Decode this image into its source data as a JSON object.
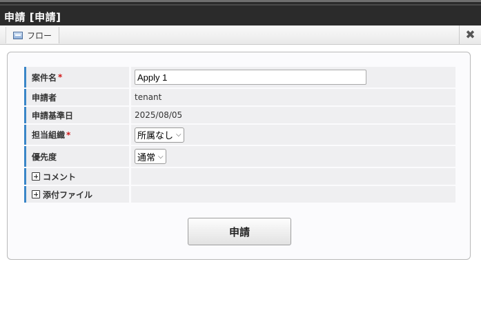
{
  "window": {
    "title": "申請 [申請]"
  },
  "toolbar": {
    "flow_label": "フロー",
    "close_icon": "close-icon"
  },
  "form": {
    "case_name": {
      "label": "案件名",
      "required_mark": "*",
      "value": "Apply 1"
    },
    "applicant": {
      "label": "申請者",
      "value": "tenant"
    },
    "base_date": {
      "label": "申請基準日",
      "value": "2025/08/05"
    },
    "organization": {
      "label": "担当組織",
      "required_mark": "*",
      "selected": "所属なし"
    },
    "priority": {
      "label": "優先度",
      "selected": "通常"
    },
    "comment": {
      "label": "コメント"
    },
    "attachments": {
      "label": "添付ファイル"
    }
  },
  "actions": {
    "apply_label": "申請"
  },
  "colors": {
    "accent": "#3a86c8",
    "required": "#d01818",
    "titlebar": "#2b2b2b"
  }
}
